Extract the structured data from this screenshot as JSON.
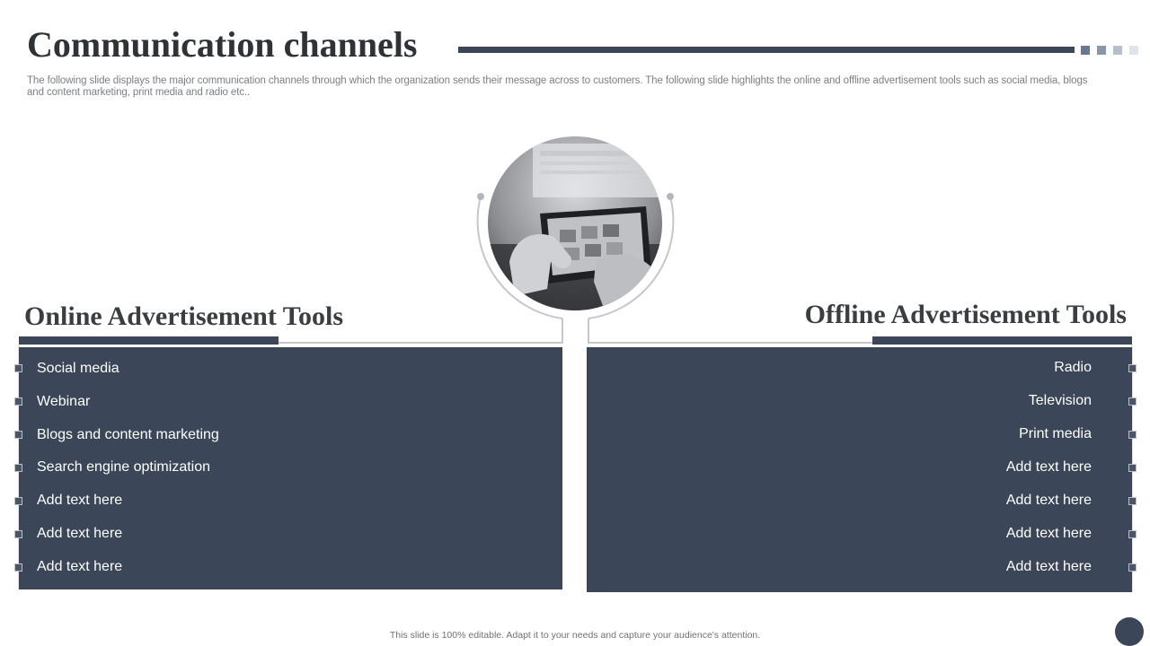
{
  "slide": {
    "title": "Communication channels",
    "subtitle": "The following slide displays the major communication channels through which the organization sends their message across to customers. The following slide highlights the online and offline advertisement tools such as social media, blogs and content marketing, print media and radio etc..",
    "footer": "This slide is 100% editable.  Adapt it to your needs and capture your audience's attention."
  },
  "online": {
    "title": "Online Advertisement  Tools",
    "items": [
      "Social media",
      "Webinar",
      "Blogs and content marketing",
      "Search engine optimization",
      "Add text here",
      "Add text here",
      "Add text here"
    ]
  },
  "offline": {
    "title": "Offline Advertisement  Tools",
    "items": [
      "Radio",
      "Television",
      "Print media",
      "Add text here",
      "Add text here",
      "Add text here",
      "Add text here"
    ]
  },
  "colors": {
    "navy": "#3b4658",
    "title_text": "#2f3236",
    "square_1": "#6a7891",
    "square_2": "#8a96aa",
    "square_3": "#b7bfcc",
    "square_4": "#dfe3ea"
  },
  "image": {
    "subject": "photo-hands-using-tablet"
  }
}
